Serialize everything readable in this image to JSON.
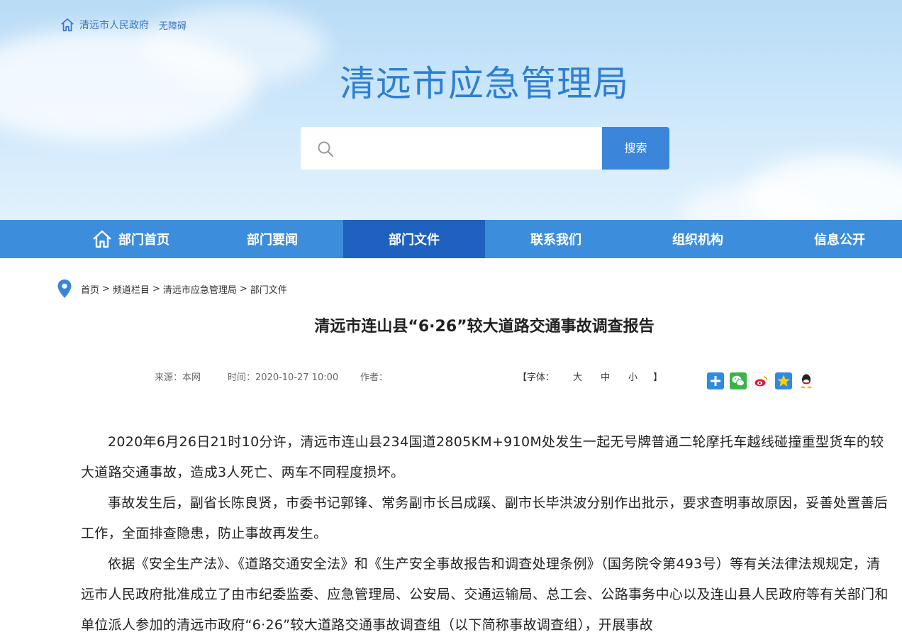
{
  "header": {
    "city_link": "清远市人民政府",
    "accessibility_link": "无障碍",
    "site_title": "清远市应急管理局",
    "search_placeholder": "",
    "search_button": "搜索"
  },
  "nav": {
    "items": [
      {
        "label": "部门首页"
      },
      {
        "label": "部门要闻"
      },
      {
        "label": "部门文件"
      },
      {
        "label": "联系我们"
      },
      {
        "label": "组织机构"
      },
      {
        "label": "信息公开"
      }
    ],
    "active_index": 2
  },
  "breadcrumb": {
    "items": [
      "首页",
      "频道栏目",
      "清远市应急管理局",
      "部门文件"
    ],
    "separator": ">"
  },
  "article": {
    "title": "清远市连山县“6·26”较大道路交通事故调查报告",
    "source": "来源：本网",
    "time": "时间：2020-10-27 10:00",
    "author": "作者：",
    "font_label_open": "【字体：",
    "font_large": "大",
    "font_medium": "中",
    "font_small": "小",
    "font_label_close": "】",
    "paragraphs": [
      "2020年6月26日21时10分许，清远市连山县234国道2805KM+910M处发生一起无号牌普通二轮摩托车越线碰撞重型货车的较大道路交通事故，造成3人死亡、两车不同程度损坏。",
      "事故发生后，副省长陈良贤，市委书记郭锋、常务副市长吕成蹊、副市长毕洪波分别作出批示，要求查明事故原因，妥善处置善后工作，全面排查隐患，防止事故再发生。",
      "依据《安全生产法》、《道路交通安全法》和《生产安全事故报告和调查处理条例》（国务院令第493号）等有关法律法规规定，清远市人民政府批准成立了由市纪委监委、应急管理局、公安局、交通运输局、总工会、公路事务中心以及连山县人民政府等有关部门和单位派人参加的清远市政府“6·26”较大道路交通事故调查组（以下简称事故调查组），开展事故"
    ]
  },
  "share": {
    "icons": [
      "share-plus-icon",
      "wechat-icon",
      "weibo-icon",
      "qzone-icon",
      "qq-icon"
    ]
  },
  "colors": {
    "nav_bg": "#3c8ddc",
    "nav_active": "#1e61bf",
    "title_blue": "#2f7fd0",
    "search_button": "#3b86db"
  }
}
